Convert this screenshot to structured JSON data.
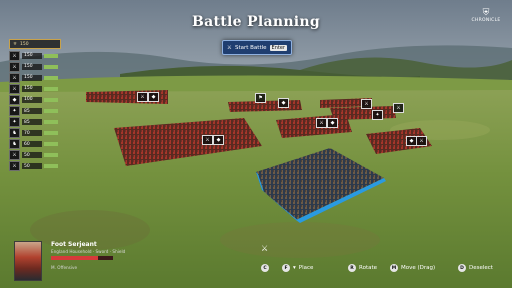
{
  "header": {
    "title": "Battle Planning",
    "start_label": "Start Battle",
    "start_key": "Enter"
  },
  "logo": {
    "text": "CHRONICLE"
  },
  "army": {
    "header_count": "150",
    "rows": [
      {
        "icon": "⚔",
        "count": "150",
        "level": 1.0
      },
      {
        "icon": "⚔",
        "count": "150",
        "level": 1.0
      },
      {
        "icon": "⚔",
        "count": "150",
        "level": 1.0
      },
      {
        "icon": "⚔",
        "count": "150",
        "level": 1.0
      },
      {
        "icon": "◆",
        "count": "100",
        "level": 1.0
      },
      {
        "icon": "✦",
        "count": "85",
        "level": 1.0
      },
      {
        "icon": "✦",
        "count": "85",
        "level": 1.0
      },
      {
        "icon": "♞",
        "count": "70",
        "level": 1.0
      },
      {
        "icon": "♞",
        "count": "60",
        "level": 1.0
      },
      {
        "icon": "⚔",
        "count": "50",
        "level": 1.0
      },
      {
        "icon": "⚔",
        "count": "50",
        "level": 1.0
      }
    ]
  },
  "selected_unit": {
    "name": "Foot Serjeant",
    "subtitle": "England Household · Sword · Shield",
    "health": 0.75,
    "footer": "M. Offensive"
  },
  "controls": [
    {
      "key": "C",
      "label": ""
    },
    {
      "key": "F",
      "label": "Place"
    },
    {
      "key": "R",
      "label": "Rotate"
    },
    {
      "key": "M",
      "label": "Move (Drag)"
    },
    {
      "key": "D",
      "label": "Deselect"
    }
  ],
  "colors": {
    "accent": "#1f3e70",
    "enemy": "#9b2c22",
    "player": "#2d5ea8",
    "health": "#d63a3a"
  }
}
